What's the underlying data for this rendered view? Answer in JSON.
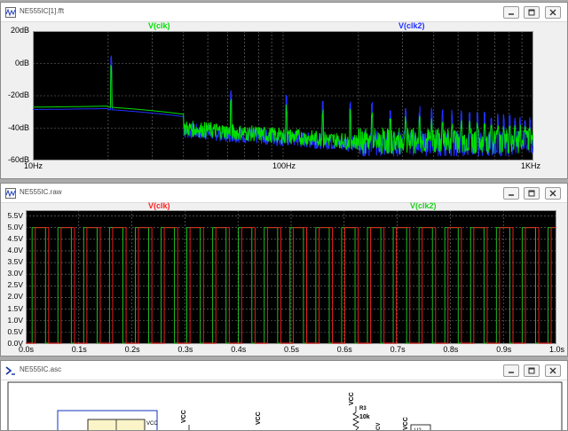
{
  "fft_window": {
    "title": "NE555IC[1].fft",
    "trace_labels": [
      {
        "text": "V(clk)",
        "color": "#00e000"
      },
      {
        "text": "V(clk2)",
        "color": "#2030ff"
      }
    ],
    "y_ticks": [
      "20dB",
      "0dB",
      "-20dB",
      "-40dB",
      "-60dB"
    ],
    "x_ticks": [
      "10Hz",
      "100Hz",
      "1KHz"
    ]
  },
  "raw_window": {
    "title": "NE555IC.raw",
    "trace_labels": [
      {
        "text": "V(clk)",
        "color": "#ff2020"
      },
      {
        "text": "V(clk2)",
        "color": "#20d020"
      }
    ],
    "y_ticks": [
      "5.5V",
      "5.0V",
      "4.5V",
      "4.0V",
      "3.5V",
      "3.0V",
      "2.5V",
      "2.0V",
      "1.5V",
      "1.0V",
      "0.5V",
      "0.0V"
    ],
    "x_ticks": [
      "0.0s",
      "0.1s",
      "0.2s",
      "0.3s",
      "0.4s",
      "0.5s",
      "0.6s",
      "0.7s",
      "0.8s",
      "0.9s",
      "1.0s"
    ]
  },
  "schematic_window": {
    "title": "NE555IC.asc",
    "labels": {
      "vcc_1": "VCC",
      "vcc_2": "VCC",
      "vcc_3": "VCC",
      "vcc_4": "VCC",
      "r3_name": "R3",
      "r3_value": "10k",
      "chip_text": "VCC",
      "u_text": "U2",
      "cv_text": "CV"
    }
  }
}
